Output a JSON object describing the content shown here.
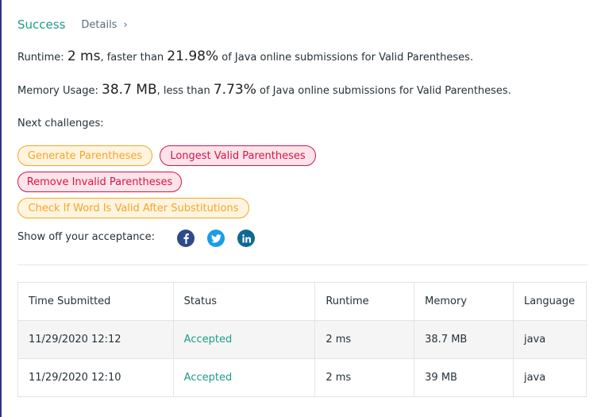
{
  "result": {
    "status_title": "Success",
    "details_label": "Details",
    "details_chevron": "›"
  },
  "runtime": {
    "label": "Runtime: ",
    "value": "2 ms",
    "middle": ", faster than ",
    "percent": "21.98%",
    "suffix": " of Java online submissions for Valid Parentheses."
  },
  "memory": {
    "label": "Memory Usage: ",
    "value": "38.7 MB",
    "middle": ", less than ",
    "percent": "7.73%",
    "suffix": " of Java online submissions for Valid Parentheses."
  },
  "next_challenges": {
    "label": "Next challenges:",
    "items": [
      {
        "label": "Generate Parentheses",
        "difficulty": "medium"
      },
      {
        "label": "Longest Valid Parentheses",
        "difficulty": "hard"
      },
      {
        "label": "Remove Invalid Parentheses",
        "difficulty": "hard"
      },
      {
        "label": "Check If Word Is Valid After Substitutions",
        "difficulty": "medium"
      }
    ]
  },
  "share": {
    "label": "Show off your acceptance:",
    "icons": [
      "facebook-icon",
      "twitter-icon",
      "linkedin-icon"
    ]
  },
  "submissions": {
    "headers": [
      "Time Submitted",
      "Status",
      "Runtime",
      "Memory",
      "Language"
    ],
    "rows": [
      {
        "time": "11/29/2020 12:12",
        "status": "Accepted",
        "runtime": "2 ms",
        "memory": "38.7 MB",
        "language": "java"
      },
      {
        "time": "11/29/2020 12:10",
        "status": "Accepted",
        "runtime": "2 ms",
        "memory": "39 MB",
        "language": "java"
      }
    ]
  },
  "colors": {
    "accent_green": "#1b9e88",
    "medium_orange": "#f5a623",
    "hard_red": "#d6144c",
    "facebook": "#2d4a8c",
    "twitter": "#1c9ce5",
    "linkedin": "#0e6a94"
  }
}
